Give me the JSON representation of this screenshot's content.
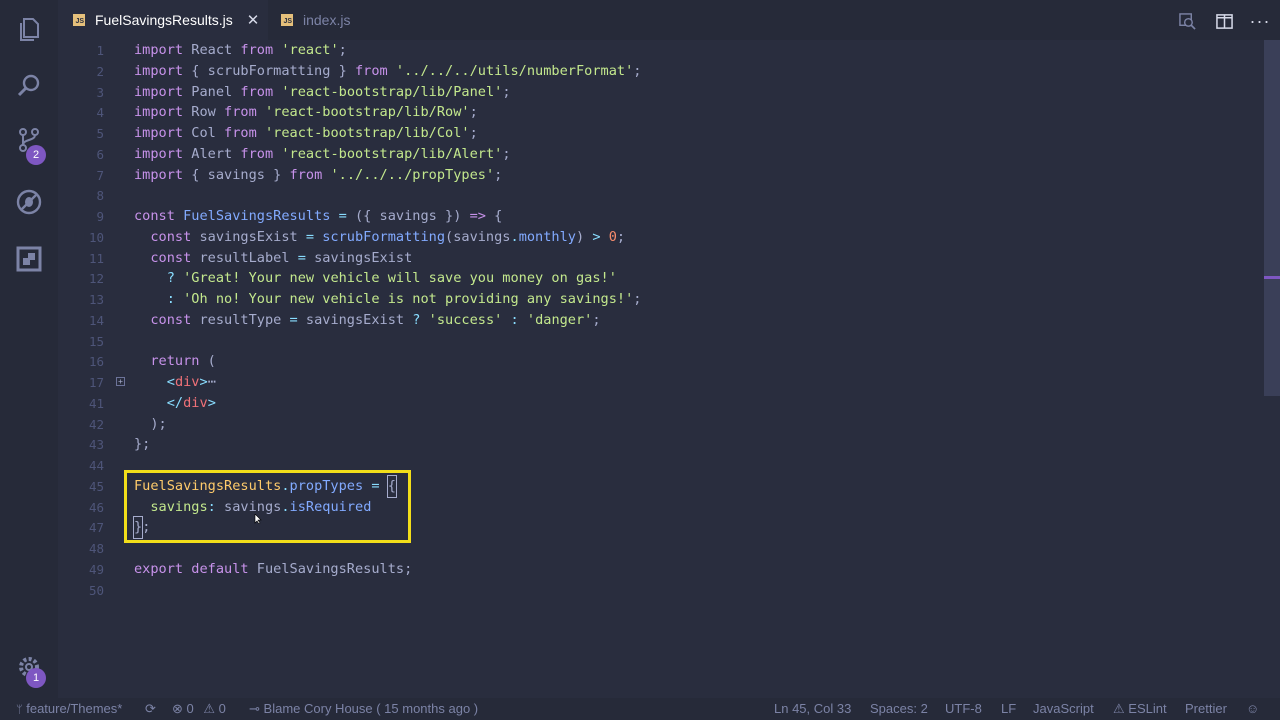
{
  "tabs": [
    {
      "label": "FuelSavingsResults.js",
      "badge": "JS",
      "active": true
    },
    {
      "label": "index.js",
      "badge": "JS",
      "active": false
    }
  ],
  "activity": {
    "scm_badge": "2",
    "settings_badge": "1"
  },
  "editor": {
    "lines": [
      {
        "n": "1"
      },
      {
        "n": "2"
      },
      {
        "n": "3"
      },
      {
        "n": "4"
      },
      {
        "n": "5"
      },
      {
        "n": "6"
      },
      {
        "n": "7"
      },
      {
        "n": "8"
      },
      {
        "n": "9"
      },
      {
        "n": "10"
      },
      {
        "n": "11"
      },
      {
        "n": "12"
      },
      {
        "n": "13"
      },
      {
        "n": "14"
      },
      {
        "n": "15"
      },
      {
        "n": "16"
      },
      {
        "n": "17"
      },
      {
        "n": "41"
      },
      {
        "n": "42"
      },
      {
        "n": "43"
      },
      {
        "n": "44"
      },
      {
        "n": "45"
      },
      {
        "n": "46"
      },
      {
        "n": "47"
      },
      {
        "n": "48"
      },
      {
        "n": "49"
      },
      {
        "n": "50"
      }
    ],
    "code": {
      "l1": [
        "import",
        " React ",
        "from",
        " ",
        "'react'",
        ";"
      ],
      "l2": [
        "import",
        " { scrubFormatting } ",
        "from",
        " ",
        "'../../../utils/numberFormat'",
        ";"
      ],
      "l3": [
        "import",
        " Panel ",
        "from",
        " ",
        "'react-bootstrap/lib/Panel'",
        ";"
      ],
      "l4": [
        "import",
        " Row ",
        "from",
        " ",
        "'react-bootstrap/lib/Row'",
        ";"
      ],
      "l5": [
        "import",
        " Col ",
        "from",
        " ",
        "'react-bootstrap/lib/Col'",
        ";"
      ],
      "l6": [
        "import",
        " Alert ",
        "from",
        " ",
        "'react-bootstrap/lib/Alert'",
        ";"
      ],
      "l7": [
        "import",
        " { savings } ",
        "from",
        " ",
        "'../../../propTypes'",
        ";"
      ],
      "l9": [
        "const",
        " ",
        "FuelSavingsResults",
        " ",
        "=",
        " ({ savings }) ",
        "=>",
        " {"
      ],
      "l10": [
        "  ",
        "const",
        " savingsExist ",
        "=",
        " ",
        "scrubFormatting",
        "(savings",
        ".",
        "monthly",
        ") ",
        ">",
        " ",
        "0",
        ";"
      ],
      "l11": [
        "  ",
        "const",
        " resultLabel ",
        "=",
        " savingsExist"
      ],
      "l12": [
        "    ",
        "?",
        " ",
        "'Great! Your new vehicle will save you money on gas!'"
      ],
      "l13": [
        "    ",
        ":",
        " ",
        "'Oh no! Your new vehicle is not providing any savings!'",
        ";"
      ],
      "l14": [
        "  ",
        "const",
        " resultType ",
        "=",
        " savingsExist ",
        "?",
        " ",
        "'success'",
        " ",
        ":",
        " ",
        "'danger'",
        ";"
      ],
      "l16": [
        "  ",
        "return",
        " ("
      ],
      "l17": [
        "    ",
        "<",
        "div",
        ">",
        "⋯"
      ],
      "l41": [
        "    ",
        "</",
        "div",
        ">"
      ],
      "l42": [
        "  );"
      ],
      "l43": [
        "};"
      ],
      "l45": [
        "FuelSavingsResults",
        ".",
        "propTypes",
        " ",
        "=",
        " ",
        "{"
      ],
      "l46": [
        "  ",
        "savings",
        ":",
        " savings",
        ".",
        "isRequired"
      ],
      "l47": [
        "}",
        ";"
      ],
      "l49": [
        "export",
        " ",
        "default",
        " FuelSavingsResults;"
      ]
    }
  },
  "status": {
    "branch": "feature/Themes*",
    "errors": "0",
    "warnings": "0",
    "blame": "Blame Cory House ( 15 months ago )",
    "position": "Ln 45, Col 33",
    "spaces": "Spaces: 2",
    "encoding": "UTF-8",
    "eol": "LF",
    "language": "JavaScript",
    "eslint": "ESLint",
    "prettier": "Prettier"
  },
  "colors": {
    "background": "#292d3e",
    "keyword": "#c792ea",
    "string": "#c3e88d",
    "function": "#82aaff",
    "class": "#ffcb6b",
    "operator": "#89ddff",
    "number": "#f78c6c",
    "tag": "#f07178",
    "highlight_box": "#f2de1a",
    "badge": "#7e57c2"
  },
  "icons": [
    "explorer-icon",
    "search-icon",
    "source-control-icon",
    "debug-icon",
    "extensions-icon",
    "settings-gear-icon",
    "open-changes-icon",
    "split-editor-icon",
    "more-actions-icon"
  ]
}
